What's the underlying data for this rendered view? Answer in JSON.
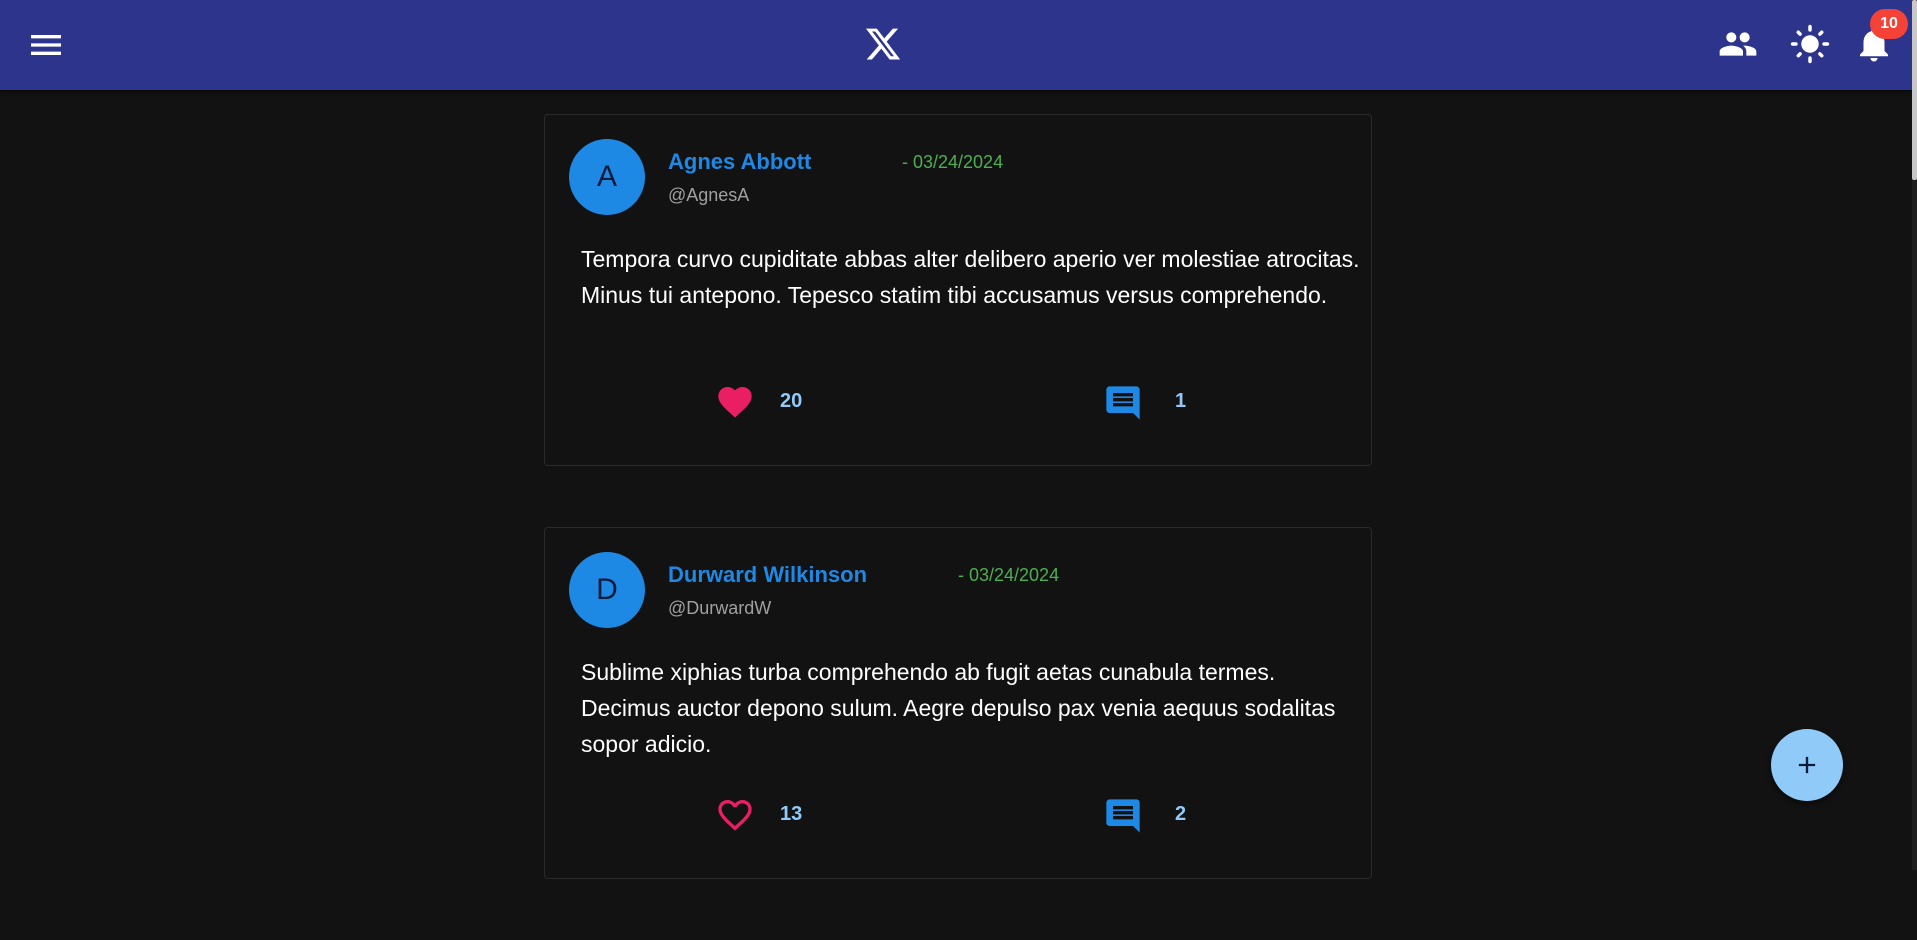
{
  "header": {
    "menu_icon": "menu-icon",
    "logo_icon": "x-logo-icon",
    "friends_icon": "people-icon",
    "theme_icon": "sun-icon",
    "notifications_icon": "bell-icon",
    "notifications_badge": "10",
    "background_color": "#2d348b"
  },
  "posts": [
    {
      "avatar_letter": "A",
      "author_name": "Agnes Abbott",
      "date": "- 03/24/2024",
      "handle": "@AgnesA",
      "text": "Tempora curvo cupiditate abbas alter delibero aperio ver molestiae atrocitas. Minus tui antepono. Tepesco statim tibi accusamus versus comprehendo.",
      "likes": "20",
      "liked": true,
      "comments": "1"
    },
    {
      "avatar_letter": "D",
      "author_name": "Durward Wilkinson",
      "date": "- 03/24/2024",
      "handle": "@DurwardW",
      "text": "Sublime xiphias turba comprehendo ab fugit aetas cunabula termes. Decimus auctor depono sulum. Aegre depulso pax venia aequus sodalitas sopor adicio.",
      "likes": "13",
      "liked": false,
      "comments": "2"
    }
  ],
  "fab": {
    "icon": "plus-icon"
  },
  "colors": {
    "accent": "#1e88e5",
    "date": "#4caf50",
    "like": "#e91e63",
    "count": "#90caf9",
    "badge": "#f44336"
  }
}
